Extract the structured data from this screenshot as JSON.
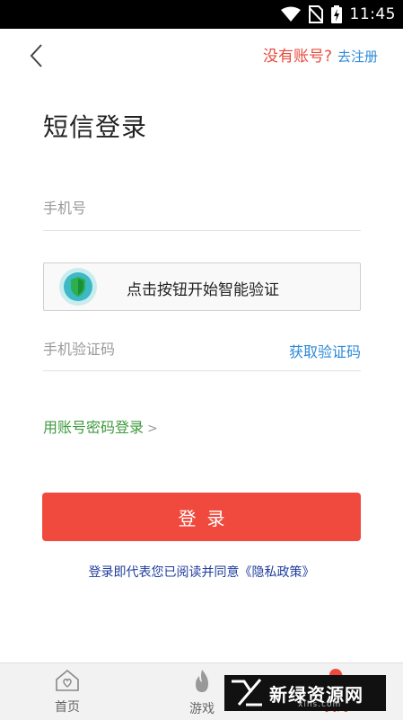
{
  "status_bar": {
    "time": "11:45",
    "icons": [
      "wifi-icon",
      "no-sim-icon",
      "battery-charging-icon"
    ]
  },
  "header": {
    "no_account": "没有账号?",
    "register": "去注册"
  },
  "page": {
    "title": "短信登录"
  },
  "form": {
    "phone_placeholder": "手机号",
    "verify_text": "点击按钮开始智能验证",
    "code_placeholder": "手机验证码",
    "get_code": "获取验证码",
    "alt_login": "用账号密码登录",
    "alt_login_arrow": ">",
    "login_button": "登录"
  },
  "agreement": {
    "prefix": "登录即代表您已阅读并同意",
    "policy": "《隐私政策》"
  },
  "bottom_nav": {
    "items": [
      {
        "label": "首页",
        "icon": "home-icon"
      },
      {
        "label": "游戏",
        "icon": "flame-icon"
      },
      {
        "label": "我的",
        "icon": "user-icon"
      }
    ]
  },
  "watermark": {
    "text": "新绿资源网",
    "sub": "xlhs.com"
  },
  "colors": {
    "accent_red": "#f04a3e",
    "link_blue": "#2d8ad8",
    "green": "#3f9a3d",
    "policy_blue": "#1f3d9c"
  }
}
